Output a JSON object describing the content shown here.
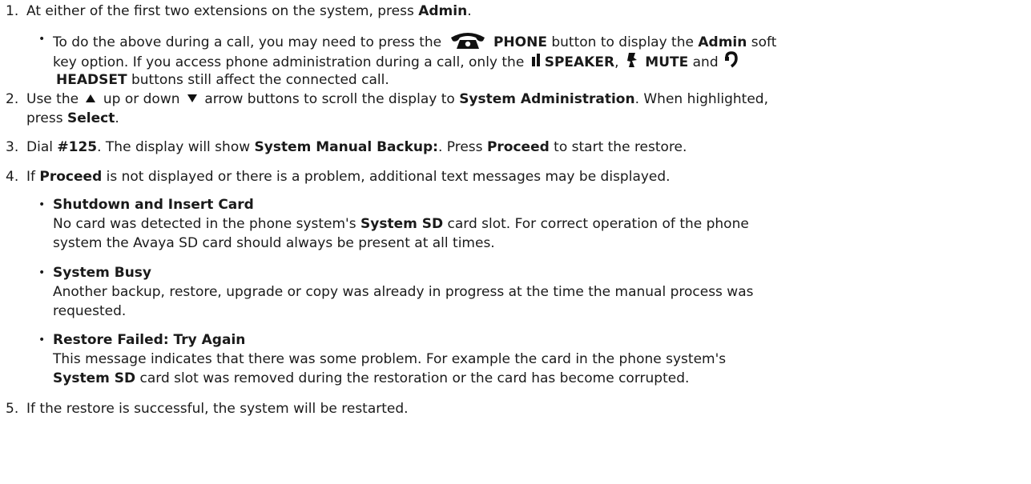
{
  "steps": [
    {
      "num": "1.",
      "pre": "At either of the first two extensions on the system, press ",
      "b1": "Admin",
      "post": ".",
      "note": {
        "l1_a": "To do the above during a call, you may need to press the",
        "l1_b": "PHONE",
        "l1_c": "button to display the",
        "l1_d": "Admin",
        "l1_e": "soft",
        "l2_a": "key option. If you access phone administration during a call, only the",
        "l2_b": "SPEAKER",
        "l2_c": ",",
        "l2_d": "MUTE",
        "l2_e": "and",
        "l3_b": "HEADSET",
        "l3_c": "buttons still affect the connected call."
      }
    },
    {
      "num": "2.",
      "a": "Use the",
      "b": "up or down",
      "c": "arrow buttons to scroll the display to",
      "d": "System Administration",
      "e": ". When highlighted,",
      "l2_a": "press",
      "l2_b": "Select",
      "l2_c": "."
    },
    {
      "num": "3.",
      "a": "Dial",
      "b": "#125",
      "c": ". The display will show",
      "d": "System Manual Backup:",
      "e": ". Press",
      "f": "Proceed",
      "g": "to start the restore."
    },
    {
      "num": "4.",
      "a": "If",
      "b": "Proceed",
      "c": "is not displayed or there is a problem, additional text messages may be displayed.",
      "messages": [
        {
          "title": "Shutdown and Insert Card",
          "l1_a": "No card was detected in the phone system's",
          "l1_b": "System SD",
          "l1_c": "card slot. For correct operation of the phone",
          "l2": "system the Avaya SD card should always be present at all times."
        },
        {
          "title": "System Busy",
          "l1": "Another backup, restore, upgrade or copy was already in progress at the time the manual process was",
          "l2": "requested."
        },
        {
          "title": "Restore Failed: Try Again",
          "l1": "This message indicates that there was some problem. For example the card in the phone system's",
          "l2_b": "System SD",
          "l2_c": "card slot was removed during the restoration or the card has become corrupted."
        }
      ]
    },
    {
      "num": "5.",
      "a": "If the restore is successful, the system will be restarted."
    }
  ],
  "icons": {
    "phone": "phone-icon",
    "speaker": "speaker-icon",
    "mute": "mute-icon",
    "headset": "headset-icon",
    "up": "up-arrow-icon",
    "down": "down-arrow-icon"
  }
}
